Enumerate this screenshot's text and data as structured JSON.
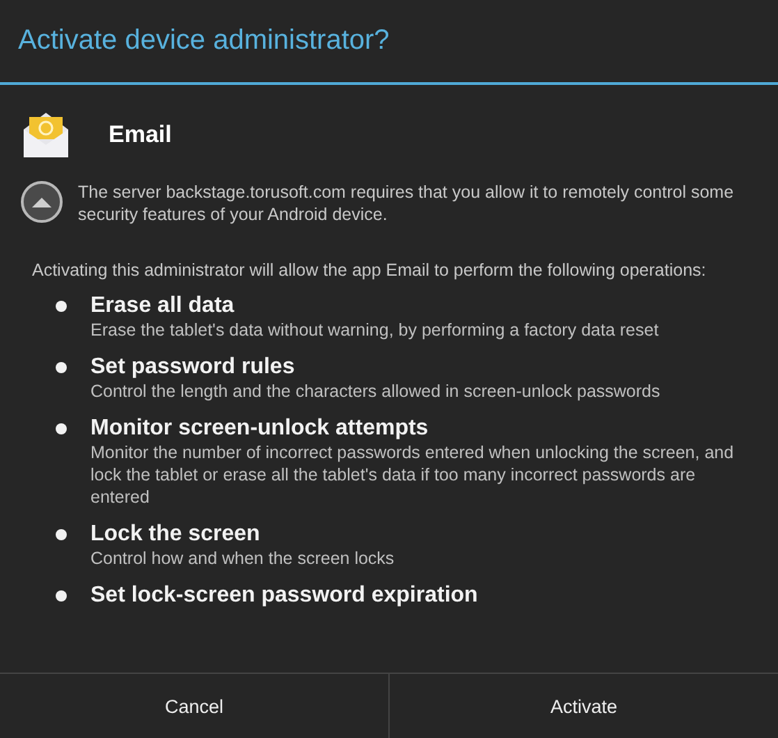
{
  "window": {
    "title": "Activate device administrator?"
  },
  "app": {
    "name": "Email"
  },
  "server_note": {
    "text": "The server backstage.torusoft.com requires that you allow it to remotely control some security features of your Android device.",
    "expanded": true
  },
  "intro": "Activating this administrator will allow the app Email to perform the following operations:",
  "policies": [
    {
      "title": "Erase all data",
      "description": "Erase the tablet's data without warning, by performing a factory data reset"
    },
    {
      "title": "Set password rules",
      "description": "Control the length and the characters allowed in screen-unlock passwords"
    },
    {
      "title": "Monitor screen-unlock attempts",
      "description": "Monitor the number of incorrect passwords entered when unlocking the screen, and lock the tablet or erase all the tablet's data if too many incorrect passwords are entered"
    },
    {
      "title": "Lock the screen",
      "description": "Control how and when the screen locks"
    },
    {
      "title": "Set lock-screen password expiration"
    }
  ],
  "buttons": [
    "Cancel",
    "Activate"
  ]
}
